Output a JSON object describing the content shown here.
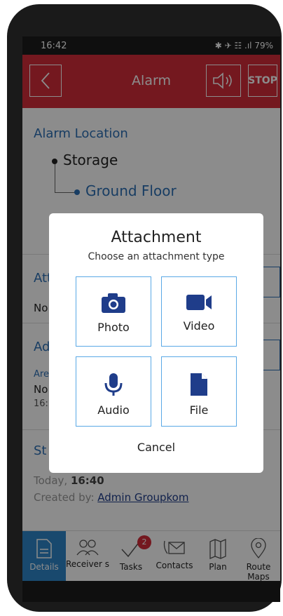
{
  "status_bar": {
    "time": "16:42",
    "icons": "✱ ✈ ☷ .ıl 79%"
  },
  "app_bar": {
    "title": "Alarm",
    "stop_label": "STOP"
  },
  "alarm_location": {
    "title": "Alarm Location",
    "building": "Storage",
    "floor": "Ground Floor"
  },
  "sections_behind": {
    "att_prefix": "Att",
    "no_prefix1": "No",
    "ad_prefix": "Ad",
    "are_prefix": "Are",
    "no_prefix2": "No",
    "time_prefix": "16:",
    "st_prefix": "St",
    "today": "Today,",
    "today_time": "16:40",
    "created_by_label": "Created by:",
    "created_by_user": "Admin Groupkom"
  },
  "dialog": {
    "title": "Attachment",
    "subtitle": "Choose an attachment type",
    "options": [
      "Photo",
      "Video",
      "Audio",
      "File"
    ],
    "cancel": "Cancel"
  },
  "tabs": [
    {
      "label": "Details",
      "icon": "document-icon"
    },
    {
      "label": "Receiver s",
      "icon": "people-icon"
    },
    {
      "label": "Tasks",
      "icon": "checkmark-icon",
      "badge": "2"
    },
    {
      "label": "Contacts",
      "icon": "envelope-icon"
    },
    {
      "label": "Plan",
      "icon": "map-icon"
    },
    {
      "label": "Route Maps",
      "icon": "location-pin-icon"
    }
  ],
  "colors": {
    "red": "#d32d3a",
    "blue": "#2c6fb5",
    "tab_active": "#2f86c9",
    "icon_blue": "#1f3d8a"
  }
}
